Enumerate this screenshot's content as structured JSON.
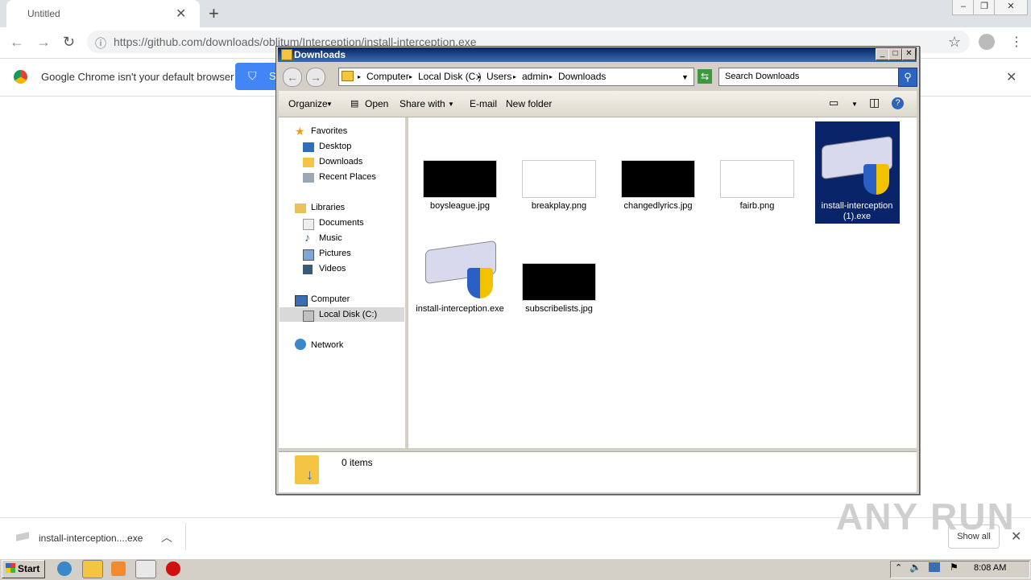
{
  "chrome": {
    "tab_title": "Untitled",
    "url": "https://github.com/downloads/oblitum/Interception/install-interception.exe",
    "infobar_text": "Google Chrome isn't your default browser",
    "setdefault_label": "S"
  },
  "explorer": {
    "title": "Downloads",
    "breadcrumbs": [
      "Computer",
      "Local Disk (C:)",
      "Users",
      "admin",
      "Downloads"
    ],
    "search_placeholder": "Search Downloads",
    "commands": [
      "Organize",
      "Open",
      "Share with",
      "E-mail",
      "New folder"
    ],
    "nav": {
      "favorites": "Favorites",
      "desktop": "Desktop",
      "downloads": "Downloads",
      "recent": "Recent Places",
      "libraries": "Libraries",
      "documents": "Documents",
      "music": "Music",
      "pictures": "Pictures",
      "videos": "Videos",
      "computer": "Computer",
      "localdisk": "Local Disk (C:)",
      "network": "Network"
    },
    "files": [
      {
        "name": "boysleague.jpg",
        "kind": "dark-image"
      },
      {
        "name": "breakplay.png",
        "kind": "light-image"
      },
      {
        "name": "changedlyrics.jpg",
        "kind": "dark-image"
      },
      {
        "name": "fairb.png",
        "kind": "light-image"
      },
      {
        "name": "install-interception (1).exe",
        "kind": "installer",
        "selected": true
      },
      {
        "name": "install-interception.exe",
        "kind": "installer"
      },
      {
        "name": "subscribelists.jpg",
        "kind": "dark-image"
      }
    ],
    "status": "0 items"
  },
  "shelf": {
    "download_name": "install-interception....exe",
    "show_all": "Show all"
  },
  "watermark": "ANY RUN",
  "taskbar": {
    "start": "Start",
    "clock": "8:08 AM"
  },
  "colors": {
    "title_blue": "#0a246a",
    "chrome_blue": "#4285f4",
    "selection": "#0a246a"
  }
}
